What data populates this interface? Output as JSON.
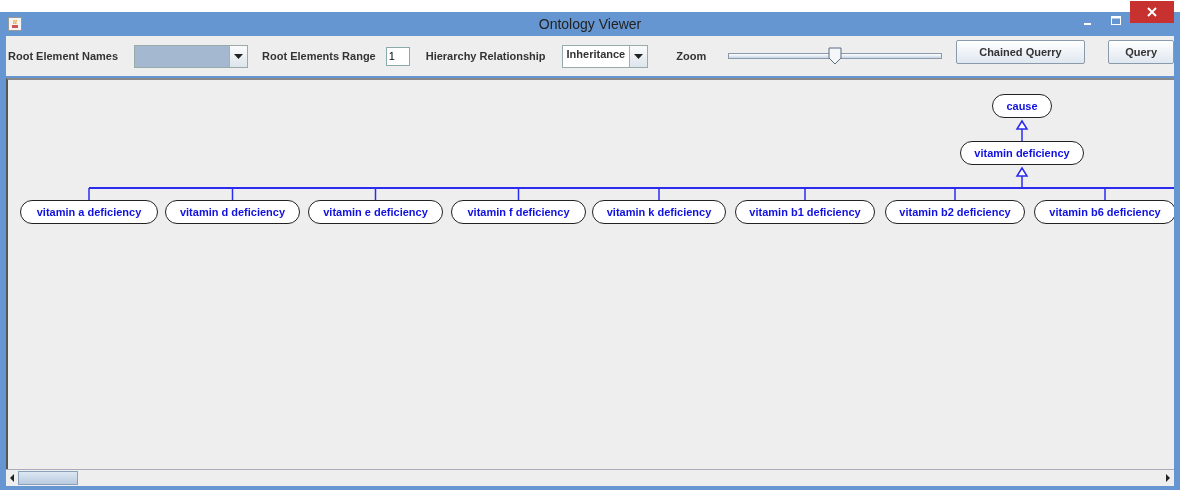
{
  "window": {
    "title": "Ontology Viewer"
  },
  "toolbar": {
    "root_names_label": "Root Element Names",
    "range_label": "Root Elements Range",
    "range_value": "1",
    "hierarchy_label": "Hierarchy Relationship",
    "hierarchy_value": "Inheritance",
    "zoom_label": "Zoom",
    "zoom": {
      "level": 0.5
    },
    "buttons": [
      "Chained Querry",
      "Query"
    ]
  },
  "graph": {
    "root": {
      "label": "cause",
      "children": [
        {
          "label": "vitamin deficiency",
          "children": [
            {
              "label": "vitamin a deficiency"
            },
            {
              "label": "vitamin d deficiency"
            },
            {
              "label": "vitamin e deficiency"
            },
            {
              "label": "vitamin f deficiency"
            },
            {
              "label": "vitamin k deficiency"
            },
            {
              "label": "vitamin b1 deficiency"
            },
            {
              "label": "vitamin b2 deficiency"
            },
            {
              "label": "vitamin b6 deficiency"
            }
          ]
        }
      ]
    }
  }
}
